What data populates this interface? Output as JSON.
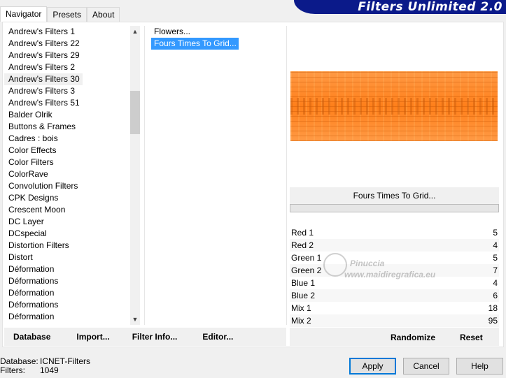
{
  "banner": {
    "title": "Filters Unlimited 2.0"
  },
  "tabs": [
    {
      "label": "Navigator",
      "active": true
    },
    {
      "label": "Presets",
      "active": false
    },
    {
      "label": "About",
      "active": false
    }
  ],
  "categories": [
    "Andrew's Filters 1",
    "Andrew's Filters 22",
    "Andrew's Filters 29",
    "Andrew's Filters 2",
    "Andrew's Filters 30",
    "Andrew's Filters 3",
    "Andrew's Filters 51",
    "Balder Olrik",
    "Buttons & Frames",
    "Cadres : bois",
    "Color Effects",
    "Color Filters",
    "ColorRave",
    "Convolution Filters",
    "CPK Designs",
    "Crescent Moon",
    "DC Layer",
    "DCspecial",
    "Distortion Filters",
    "Distort",
    "Déformation",
    "Déformations",
    "Déformation",
    "Déformations",
    "Déformation"
  ],
  "selected_category_index": 4,
  "filters": [
    "Flowers...",
    "Fours Times To Grid..."
  ],
  "selected_filter_index": 1,
  "preview": {
    "filter_name": "Fours Times To Grid...",
    "progress": 0
  },
  "params": [
    {
      "label": "Red 1",
      "value": "5"
    },
    {
      "label": "Red 2",
      "value": "4"
    },
    {
      "label": "Green 1",
      "value": "5"
    },
    {
      "label": "Green 2",
      "value": "7"
    },
    {
      "label": "Blue 1",
      "value": "4"
    },
    {
      "label": "Blue 2",
      "value": "6"
    },
    {
      "label": "Mix 1",
      "value": "18"
    },
    {
      "label": "Mix 2",
      "value": "95"
    }
  ],
  "watermark": {
    "name": "Pinuccia",
    "url": "www.maidiregrafica.eu"
  },
  "toolbar": {
    "database": "Database",
    "import": "Import...",
    "filter_info": "Filter Info...",
    "editor": "Editor...",
    "randomize": "Randomize",
    "reset": "Reset"
  },
  "footer": {
    "database_label": "Database:",
    "database_value": "ICNET-Filters",
    "filters_label": "Filters:",
    "filters_value": "1049"
  },
  "buttons": {
    "apply": "Apply",
    "cancel": "Cancel",
    "help": "Help"
  },
  "colors": {
    "banner": "#0b1a8a",
    "selection": "#3399ff",
    "preview_orange": "#ff8c2b",
    "default_button_border": "#0078d7"
  },
  "icons": {
    "scroll_up": "chevron-up-icon",
    "scroll_down": "chevron-down-icon"
  }
}
